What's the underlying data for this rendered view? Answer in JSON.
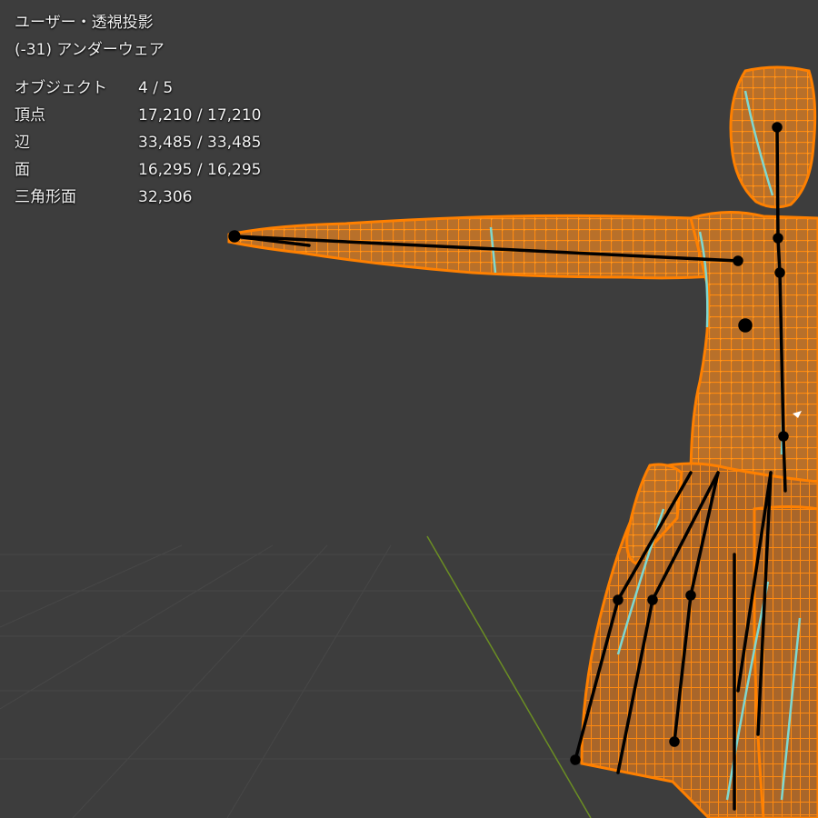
{
  "viewport": {
    "view_label": "ユーザー・透視投影",
    "active_object": "(-31) アンダーウェア",
    "stats": [
      {
        "label": "オブジェクト",
        "value": "4 / 5"
      },
      {
        "label": "頂点",
        "value": "17,210 / 17,210"
      },
      {
        "label": "辺",
        "value": "33,485 / 33,485"
      },
      {
        "label": "面",
        "value": "16,295 / 16,295"
      },
      {
        "label": "三角形面",
        "value": "32,306"
      }
    ]
  },
  "colors": {
    "background": "#3d3d3d",
    "grid": "#4a4a4a",
    "y_axis": "#6b8e23",
    "mesh_selected": "#ff8000",
    "mesh_fill": "#b26a20",
    "armature": "#000000",
    "seam": "#7fd8d0"
  }
}
